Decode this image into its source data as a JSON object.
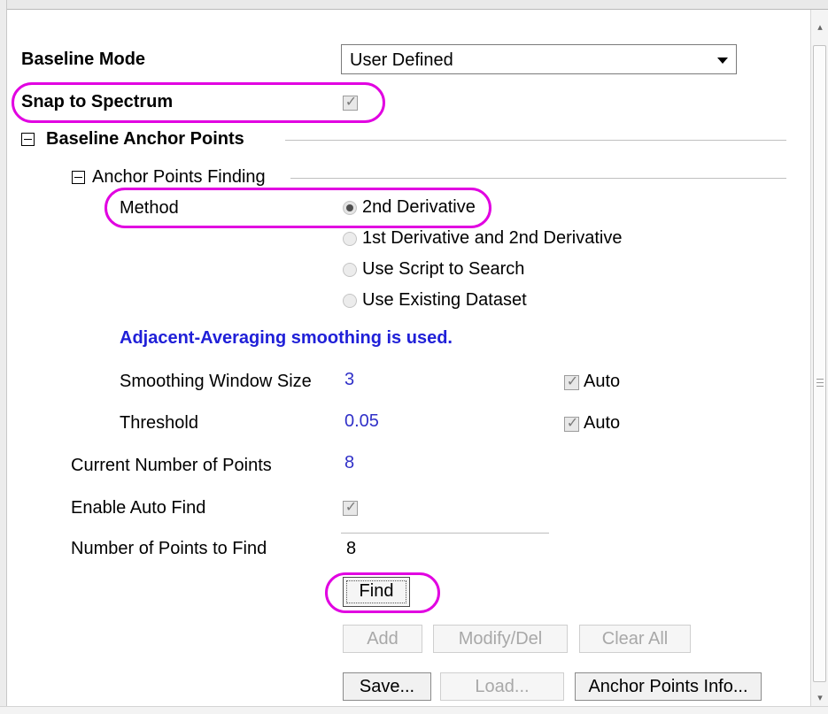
{
  "baseline_mode": {
    "label": "Baseline Mode",
    "value": "User Defined"
  },
  "snap_to_spectrum": {
    "label": "Snap to Spectrum",
    "checked": true
  },
  "baseline_anchor_points": {
    "label": "Baseline Anchor Points",
    "anchor_points_finding": {
      "label": "Anchor Points Finding",
      "method_label": "Method",
      "method_options": [
        {
          "label": "2nd Derivative",
          "selected": true
        },
        {
          "label": "1st Derivative and 2nd Derivative",
          "selected": false
        },
        {
          "label": "Use Script to Search",
          "selected": false
        },
        {
          "label": "Use Existing Dataset",
          "selected": false
        }
      ],
      "smoothing_note": "Adjacent-Averaging smoothing is used.",
      "smoothing_window_size": {
        "label": "Smoothing Window Size",
        "value": "3",
        "auto_label": "Auto",
        "auto": true
      },
      "threshold": {
        "label": "Threshold",
        "value": "0.05",
        "auto_label": "Auto",
        "auto": true
      }
    },
    "current_number_of_points": {
      "label": "Current Number of Points",
      "value": "8"
    },
    "enable_auto_find": {
      "label": "Enable Auto Find",
      "checked": true
    },
    "number_of_points_to_find": {
      "label": "Number of Points to Find",
      "value": "8"
    }
  },
  "buttons": {
    "find": "Find",
    "add": "Add",
    "modify_del": "Modify/Del",
    "clear_all": "Clear All",
    "save": "Save...",
    "load": "Load...",
    "anchor_points_info": "Anchor Points Info..."
  },
  "highlight_color": "#e100e1",
  "note_color": "#2020d8"
}
